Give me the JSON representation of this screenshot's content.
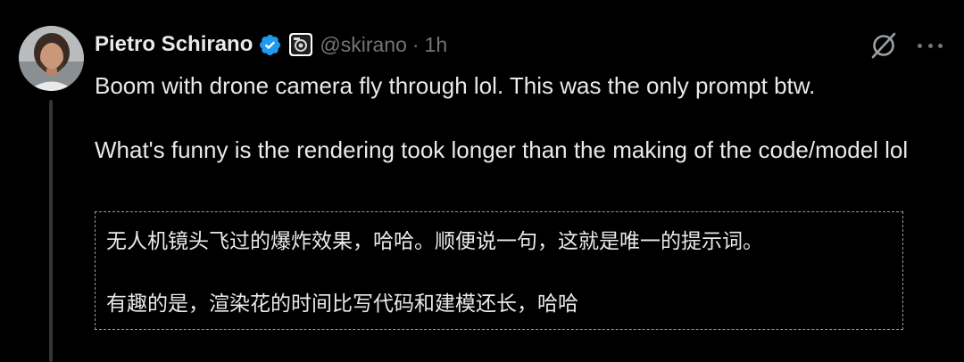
{
  "author": {
    "display_name": "Pietro Schirano",
    "handle": "@skirano",
    "separator": "·",
    "time": "1h",
    "verified_icon": "verified-badge-icon",
    "affiliation_icon": "affiliation-badge-icon"
  },
  "actions": {
    "grok_icon": "grok-slash-icon",
    "more_icon": "more-options-icon"
  },
  "tweet": {
    "line1": "Boom with drone camera fly through lol. This was the only prompt btw.",
    "line2": "What's funny is the rendering took longer than the making of the code/model lol"
  },
  "translation": {
    "line1": "无人机镜头飞过的爆炸效果，哈哈。顺便说一句，这就是唯一的提示词。",
    "line2": "有趣的是，渲染花的时间比写代码和建模还长，哈哈"
  },
  "colors": {
    "background": "#000000",
    "text": "#e7e9ea",
    "secondary": "#71767b",
    "verified": "#1d9bf0",
    "thread_line": "#333639",
    "dashed_border": "#8f9bb3"
  }
}
